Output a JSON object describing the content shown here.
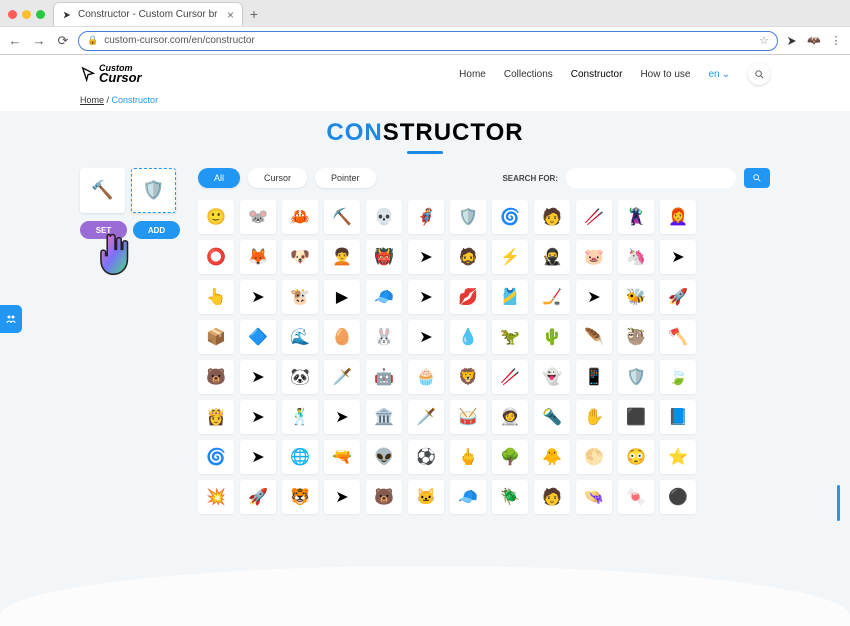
{
  "browser": {
    "tab_title": "Constructor - Custom Cursor br",
    "url": "custom-cursor.com/en/constructor"
  },
  "header": {
    "logo_top": "Custom",
    "logo_bottom": "Cursor",
    "nav": {
      "home": "Home",
      "collections": "Collections",
      "constructor": "Constructor",
      "howto": "How to use",
      "lang": "en"
    }
  },
  "breadcrumb": {
    "home": "Home",
    "current": "Constructor"
  },
  "title": {
    "first": "CON",
    "second": "STRUCTOR"
  },
  "left": {
    "set": "SET",
    "add": "ADD"
  },
  "filters": {
    "all": "All",
    "cursor": "Cursor",
    "pointer": "Pointer",
    "search_label": "SEARCH FOR:"
  },
  "slot_icons": [
    "🔨",
    "🛡️"
  ],
  "grid": [
    [
      "🙂",
      "🐭",
      "🦀",
      "⛏️",
      "💀",
      "🦸",
      "🛡️",
      "🌀",
      "🧑",
      "🥢",
      "🦹",
      "👩‍🦰"
    ],
    [
      "⭕",
      "🦊",
      "🐶",
      "🧑‍🦱",
      "👹",
      "➤",
      "🧔",
      "⚡",
      "🥷",
      "🐷",
      "🦄",
      "➤"
    ],
    [
      "👆",
      "➤",
      "🐮",
      "▶",
      "🧢",
      "➤",
      "💋",
      "🎽",
      "🏒",
      "➤",
      "🐝",
      "🚀"
    ],
    [
      "📦",
      "🔷",
      "🌊",
      "🥚",
      "🐰",
      "➤",
      "💧",
      "🦖",
      "🌵",
      "🪶",
      "🦥",
      "🪓"
    ],
    [
      "🐻",
      "➤",
      "🐼",
      "🗡️",
      "🤖",
      "🧁",
      "🦁",
      "🥢",
      "👻",
      "📱",
      "🛡️",
      "🍃"
    ],
    [
      "👸",
      "➤",
      "🕺",
      "➤",
      "🏛️",
      "🗡️",
      "🥁",
      "🧑‍🚀",
      "🔦",
      "✋",
      "⬛",
      "📘"
    ],
    [
      "🌀",
      "➤",
      "🌐",
      "🔫",
      "👽",
      "⚽",
      "🖕",
      "🌳",
      "🐥",
      "🌕",
      "😳",
      "⭐"
    ],
    [
      "💥",
      "🚀",
      "🐯",
      "➤",
      "🐻",
      "🐱",
      "🧢",
      "🪲",
      "🧑",
      "👒",
      "🍬",
      "⚫"
    ]
  ]
}
